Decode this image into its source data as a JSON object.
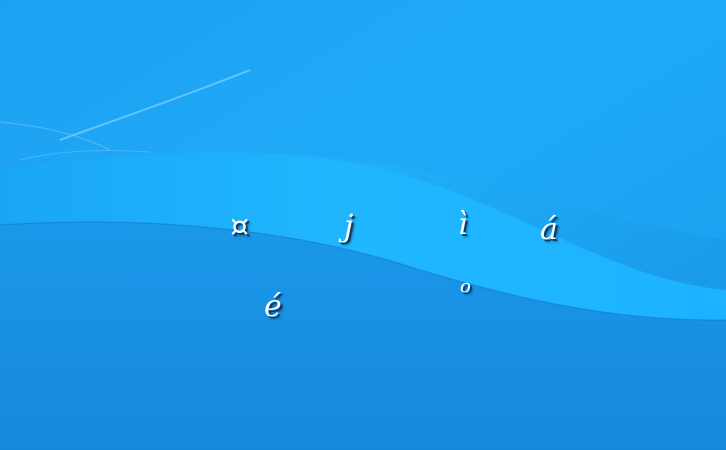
{
  "desktop": {
    "glyphs": [
      "¤",
      "j",
      "ì",
      "á",
      "é",
      "o"
    ]
  },
  "colors": {
    "background_top": "#22b4fb",
    "background_bottom": "#1690e0",
    "wave_light": "#1fb8ff",
    "glyph_text": "#ffffff",
    "glyph_shadow": "#0d3d66"
  }
}
